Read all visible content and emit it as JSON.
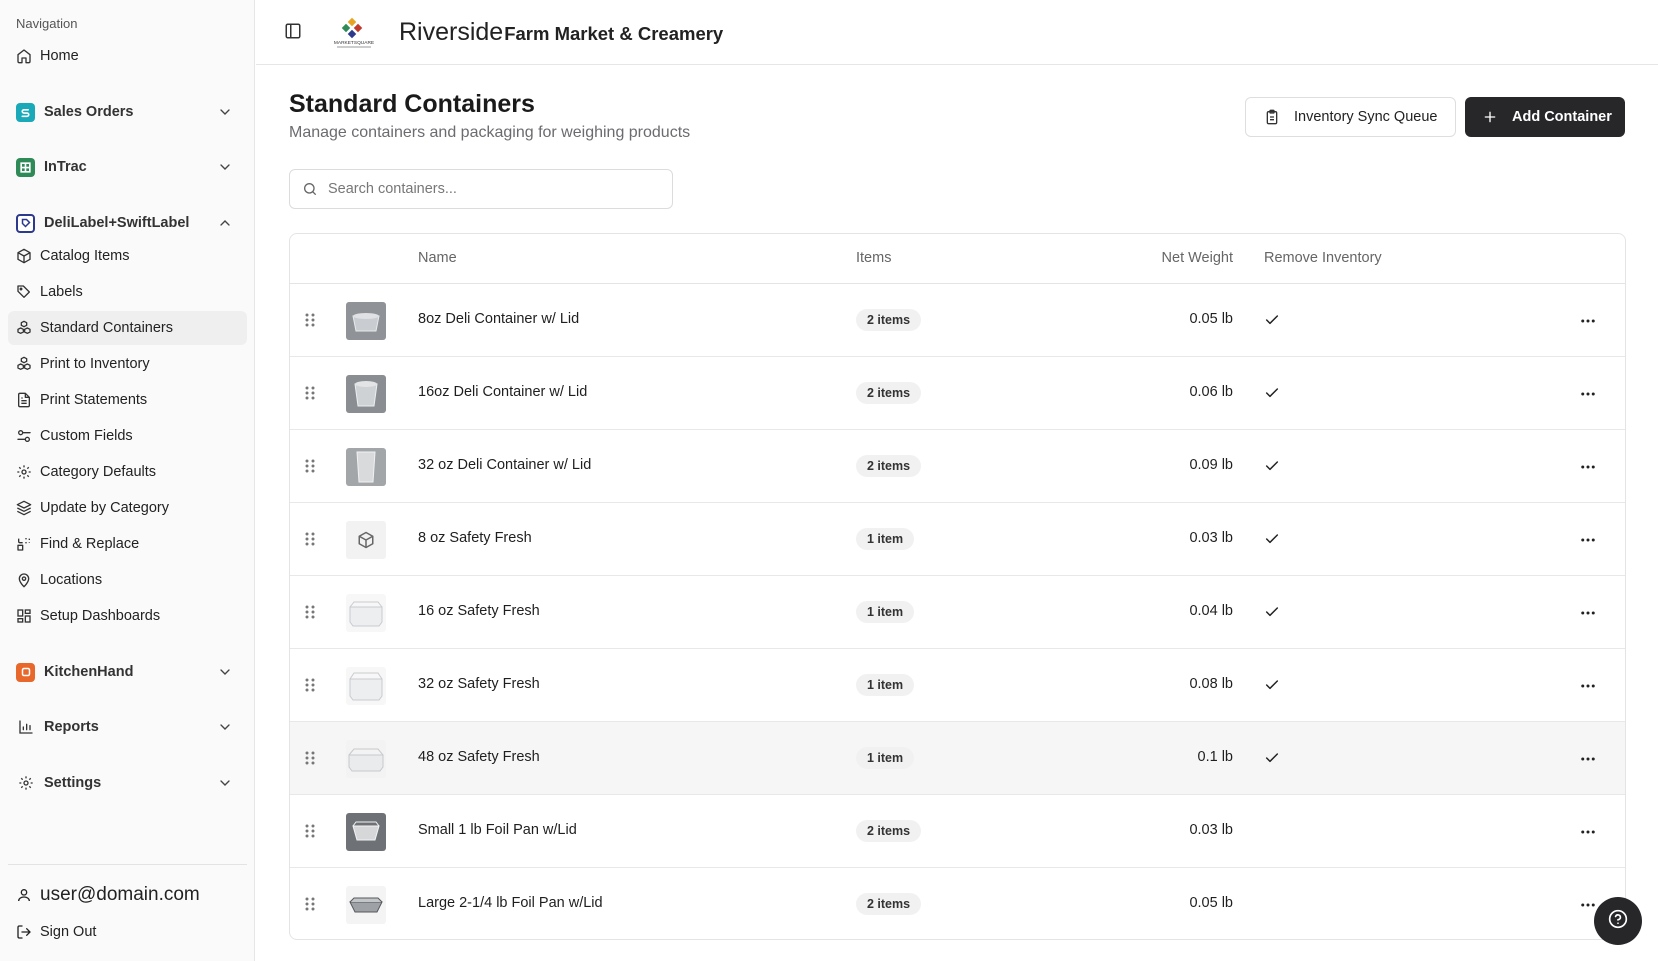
{
  "sidebar": {
    "heading": "Navigation",
    "home": "Home",
    "groups": {
      "sales_orders": "Sales Orders",
      "intrac": "InTrac",
      "delilabel": "DeliLabel+SwiftLabel",
      "kitchenhand": "KitchenHand",
      "reports": "Reports",
      "settings": "Settings"
    },
    "items": [
      {
        "label": "Catalog Items",
        "icon": "package-icon"
      },
      {
        "label": "Labels",
        "icon": "tags-icon"
      },
      {
        "label": "Standard Containers",
        "icon": "boxes-icon",
        "active": true
      },
      {
        "label": "Print to Inventory",
        "icon": "boxes-icon"
      },
      {
        "label": "Print Statements",
        "icon": "file-text-icon"
      },
      {
        "label": "Custom Fields",
        "icon": "sliders-icon"
      },
      {
        "label": "Category Defaults",
        "icon": "gear-icon"
      },
      {
        "label": "Update by Category",
        "icon": "layers-icon"
      },
      {
        "label": "Find & Replace",
        "icon": "replace-icon"
      },
      {
        "label": "Locations",
        "icon": "map-pin-icon"
      },
      {
        "label": "Setup Dashboards",
        "icon": "dashboard-icon"
      }
    ],
    "user_email": "user@domain.com",
    "sign_out": "Sign Out"
  },
  "header": {
    "brand_main": "Riverside",
    "brand_sub": "Farm Market & Creamery",
    "logo_text": "MARKETSQUARE"
  },
  "main": {
    "title": "Standard Containers",
    "subtitle": "Manage containers and packaging for weighing products",
    "sync_button": "Inventory Sync Queue",
    "add_button": "Add Container",
    "search_placeholder": "Search containers...",
    "columns": {
      "name": "Name",
      "items": "Items",
      "net_weight": "Net Weight",
      "remove_inventory": "Remove Inventory"
    },
    "rows": [
      {
        "name": "8oz Deli Container w/ Lid",
        "items": "2 items",
        "weight": "0.05 lb",
        "remove": true,
        "thumb": "deli-small"
      },
      {
        "name": "16oz Deli Container w/ Lid",
        "items": "2 items",
        "weight": "0.06 lb",
        "remove": true,
        "thumb": "deli-medium"
      },
      {
        "name": "32 oz Deli Container w/ Lid",
        "items": "2 items",
        "weight": "0.09 lb",
        "remove": true,
        "thumb": "deli-tall"
      },
      {
        "name": "8 oz Safety Fresh",
        "items": "1 item",
        "weight": "0.03 lb",
        "remove": true,
        "thumb": "placeholder"
      },
      {
        "name": "16 oz Safety Fresh",
        "items": "1 item",
        "weight": "0.04 lb",
        "remove": true,
        "thumb": "clear-box"
      },
      {
        "name": "32 oz Safety Fresh",
        "items": "1 item",
        "weight": "0.08 lb",
        "remove": true,
        "thumb": "clear-box"
      },
      {
        "name": "48 oz Safety Fresh",
        "items": "1 item",
        "weight": "0.1 lb",
        "remove": true,
        "thumb": "clear-box"
      },
      {
        "name": "Small 1 lb Foil Pan w/Lid",
        "items": "2 items",
        "weight": "0.03 lb",
        "remove": false,
        "thumb": "foil-small"
      },
      {
        "name": "Large 2-1/4 lb Foil Pan w/Lid",
        "items": "2 items",
        "weight": "0.05 lb",
        "remove": false,
        "thumb": "foil-large"
      }
    ]
  },
  "colors": {
    "primary_button": "#27272a",
    "sales_orders_icon": "#1aa9b8",
    "intrac_icon": "#2e8b57",
    "delilabel_icon": "#2b3a8c",
    "kitchenhand_icon": "#e8672a"
  }
}
